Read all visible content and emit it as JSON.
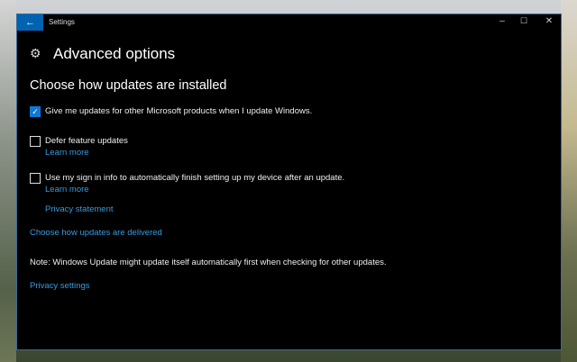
{
  "window": {
    "title": "Settings",
    "back_icon": "arrow-left-icon",
    "controls": {
      "minimize": "–",
      "maximize": "☐",
      "close": "✕"
    }
  },
  "page": {
    "title": "Advanced options",
    "icon": "gear-icon"
  },
  "section": {
    "heading": "Choose how updates are installed"
  },
  "options": [
    {
      "label": "Give me updates for other Microsoft products when I update Windows.",
      "checked": true
    },
    {
      "label": "Defer feature updates",
      "checked": false,
      "link": "Learn more"
    },
    {
      "label": "Use my sign in info to automatically finish setting up my device after an update.",
      "checked": false,
      "link": "Learn more",
      "link2": "Privacy statement"
    }
  ],
  "links": {
    "delivered": "Choose how updates are delivered",
    "privacy_settings": "Privacy settings"
  },
  "note": "Note: Windows Update might update itself automatically first when checking for other updates.",
  "colors": {
    "accent": "#0063b1",
    "link": "#3a9be0"
  }
}
